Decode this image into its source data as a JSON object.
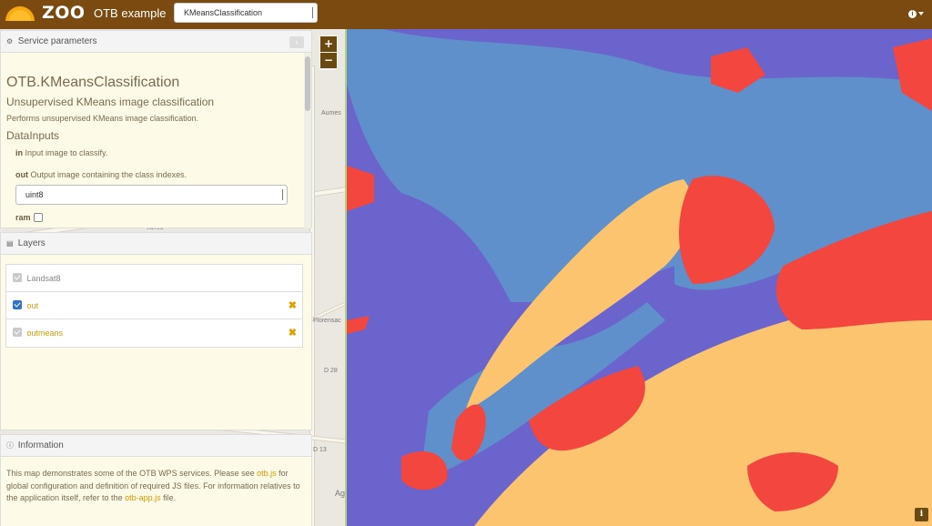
{
  "header": {
    "logo_text": "ZOO",
    "app_title": "OTB example",
    "service_select": "KMeansClassification"
  },
  "map": {
    "zoom_in": "+",
    "zoom_out": "−",
    "labels": [
      "Aumes",
      "Florensac",
      "D 28",
      "D 13",
      "Valros",
      "Ag"
    ],
    "class_colors": {
      "water": "#6a64cc",
      "vegetation": "#5f90cb",
      "urban": "#f3463f",
      "bare_soil": "#fcc46e"
    }
  },
  "service_panel": {
    "heading": "Service parameters",
    "title": "OTB.KMeansClassification",
    "subtitle": "Unsupervised KMeans image classification",
    "description": "Performs unsupervised KMeans image classification.",
    "section": "DataInputs",
    "params": [
      {
        "name": "in",
        "description": "Input image to classify."
      },
      {
        "name": "out",
        "description": "Output image containing the class indexes."
      }
    ],
    "out_type": "uint8",
    "ram_label": "ram"
  },
  "layers_panel": {
    "heading": "Layers",
    "items": [
      {
        "name": "Landsat8",
        "checked": true,
        "removable": false
      },
      {
        "name": "out",
        "checked": true,
        "removable": true
      },
      {
        "name": "outmeans",
        "checked": true,
        "removable": true
      }
    ]
  },
  "info_panel": {
    "heading": "Information",
    "text_1": "This map demonstrates some of the OTB WPS services. Please see ",
    "link_1": "otb.js",
    "text_2": " for global configuration and definition of required JS files. For information relatives to the application itself, refer to the ",
    "link_2": "otb-app.js",
    "text_3": " file."
  },
  "corner_info": "i"
}
